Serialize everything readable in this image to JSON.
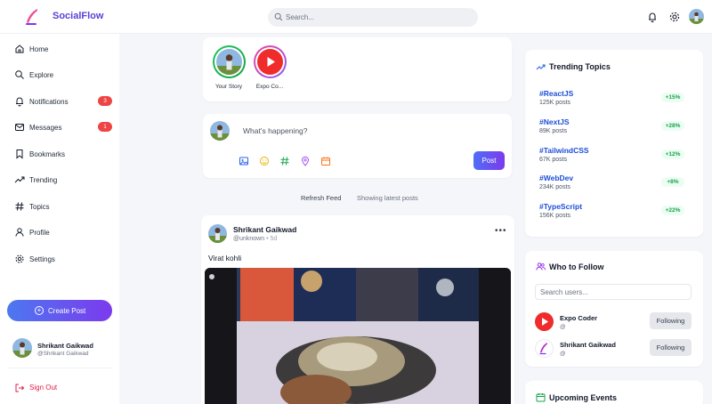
{
  "header": {
    "brand": "SocialFlow",
    "search_placeholder": "Search..."
  },
  "sidebar": {
    "items": [
      {
        "label": "Home",
        "icon": "home-icon"
      },
      {
        "label": "Explore",
        "icon": "search-icon"
      },
      {
        "label": "Notifications",
        "icon": "bell-icon",
        "badge": "3"
      },
      {
        "label": "Messages",
        "icon": "mail-icon",
        "badge": "1"
      },
      {
        "label": "Bookmarks",
        "icon": "bookmark-icon"
      },
      {
        "label": "Trending",
        "icon": "trending-icon"
      },
      {
        "label": "Topics",
        "icon": "hash-icon"
      },
      {
        "label": "Profile",
        "icon": "user-icon"
      },
      {
        "label": "Settings",
        "icon": "gear-icon"
      }
    ],
    "create_post": "Create Post",
    "user": {
      "name": "Shrikant Gaikwad",
      "handle": "@Shrikant Gaikwad"
    },
    "sign_out": "Sign Out"
  },
  "stories": [
    {
      "label": "Your Story"
    },
    {
      "label": "Expo Co..."
    }
  ],
  "composer": {
    "placeholder": "What's happening?",
    "post_button": "Post"
  },
  "feed": {
    "refresh": "Refresh Feed",
    "status": "Showing latest posts"
  },
  "post": {
    "author": "Shrikant Gaikwad",
    "handle": "@unknown",
    "time": "• 5d",
    "text": "Virat kohli",
    "more": "•••"
  },
  "trending": {
    "title": "Trending Topics",
    "topics": [
      {
        "tag": "#ReactJS",
        "count": "125K posts",
        "change": "+15%"
      },
      {
        "tag": "#NextJS",
        "count": "89K posts",
        "change": "+28%"
      },
      {
        "tag": "#TailwindCSS",
        "count": "67K posts",
        "change": "+12%"
      },
      {
        "tag": "#WebDev",
        "count": "234K posts",
        "change": "+8%"
      },
      {
        "tag": "#TypeScript",
        "count": "156K posts",
        "change": "+22%"
      }
    ]
  },
  "who_to_follow": {
    "title": "Who to Follow",
    "search_placeholder": "Search users...",
    "users": [
      {
        "name": "Expo Coder",
        "handle": "@",
        "button": "Following"
      },
      {
        "name": "Shrikant Gaikwad",
        "handle": "@",
        "button": "Following"
      }
    ]
  },
  "events": {
    "title": "Upcoming Events"
  },
  "colors": {
    "accent": "#5b3fd8",
    "link": "#1d4ed8",
    "badge": "#ef4444",
    "positive": "#16a34a",
    "signout": "#e11d48"
  }
}
